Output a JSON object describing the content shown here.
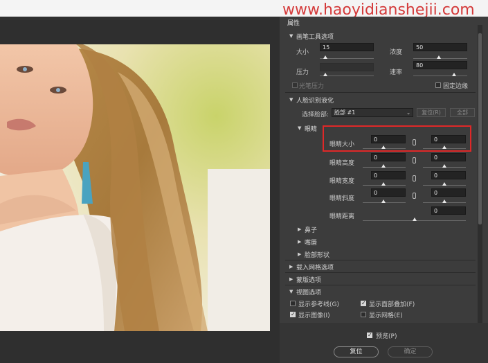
{
  "watermark": "www.haoyidianshejii.com",
  "panel": {
    "title": "属性",
    "brush": {
      "header": "画笔工具选项",
      "size_label": "大小",
      "size_value": "15",
      "density_label": "浓度",
      "density_value": "50",
      "pressure_label": "压力",
      "rate_label": "速率",
      "rate_value": "80",
      "stylus_label": "光笔压力",
      "pin_edges_label": "固定边缘"
    },
    "face": {
      "header": "人脸识别液化",
      "select_label": "选择脸部:",
      "select_value": "脸部 #1",
      "reset_label": "复位(R)",
      "all_label": "全部"
    },
    "eyes": {
      "header": "眼睛",
      "size_label": "眼睛大小",
      "size_left": "0",
      "size_right": "0",
      "height_label": "眼睛高度",
      "height_left": "0",
      "height_right": "0",
      "width_label": "眼睛宽度",
      "width_left": "0",
      "width_right": "0",
      "tilt_label": "眼睛斜度",
      "tilt_left": "0",
      "tilt_right": "0",
      "distance_label": "眼睛距离",
      "distance_value": "0"
    },
    "collapsed": {
      "nose": "鼻子",
      "mouth": "嘴唇",
      "face_shape": "脸部形状",
      "load_mesh": "载入网格选项",
      "mask": "蒙版选项"
    },
    "view": {
      "header": "视图选项",
      "show_guides": "显示参考线(G)",
      "show_face_overlay": "显示面部叠加(F)",
      "show_image": "显示图像(I)",
      "show_mesh": "显示网格(E)"
    },
    "preview_label": "预览(P)",
    "reset_button": "复位",
    "ok_button": "确定"
  }
}
